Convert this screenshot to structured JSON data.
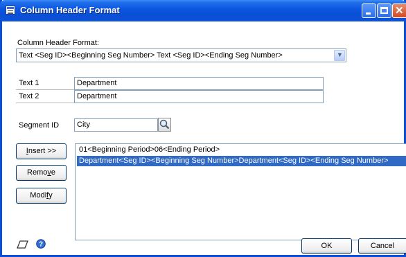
{
  "window": {
    "title": "Column Header Format"
  },
  "header_format": {
    "label": "Column Header Format:",
    "selected": "Text <Seg ID><Beginning Seg Number> Text <Seg ID><Ending Seg Number>"
  },
  "fields": {
    "text1": {
      "label": "Text 1",
      "value": "Department"
    },
    "text2": {
      "label": "Text 2",
      "value": "Department"
    },
    "segment_id": {
      "label": "Segment ID",
      "value": "City"
    }
  },
  "buttons": {
    "insert": {
      "pre": "",
      "ul": "I",
      "post": "nsert >>"
    },
    "remove": {
      "pre": "Remo",
      "ul": "v",
      "post": "e"
    },
    "modify": {
      "pre": "Modi",
      "ul": "f",
      "post": "y"
    },
    "ok": "OK",
    "cancel": "Cancel"
  },
  "list": {
    "items": [
      "01<Beginning Period>06<Ending Period>",
      "Department<Seg ID><Beginning Seg Number>Department<Seg ID><Ending Seg Number>"
    ],
    "selected_index": 1
  },
  "icons": {
    "window": "window-icon",
    "lookup": "lookup-icon",
    "note": "note-icon",
    "help": "help-icon"
  },
  "colors": {
    "titlebar": "#0a4fd6",
    "selection": "#316ac5"
  }
}
